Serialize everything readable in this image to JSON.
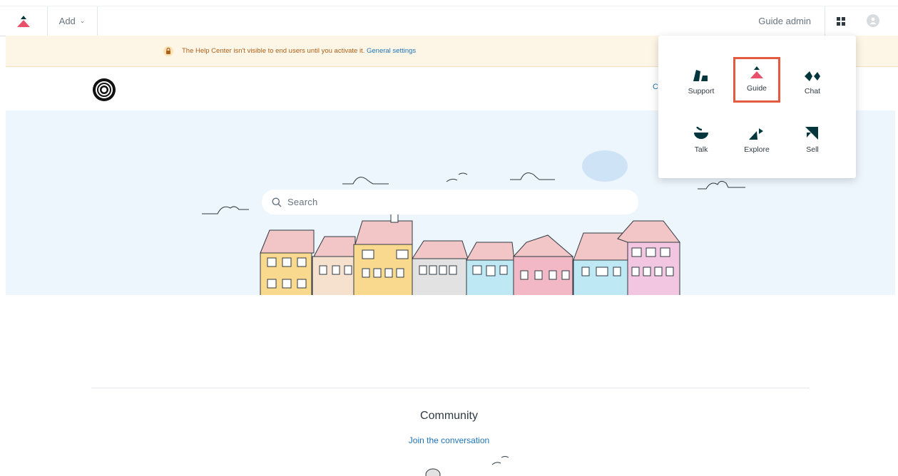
{
  "topbar": {
    "add_label": "Add",
    "admin_label": "Guide admin"
  },
  "notice": {
    "message": "The Help Center isn't visible to end users until you activate it.",
    "link_label": "General settings"
  },
  "hero": {
    "search_placeholder": "Search"
  },
  "header": {
    "nav_peek": "C"
  },
  "community": {
    "title": "Community",
    "link_label": "Join the conversation"
  },
  "product_tray": {
    "items": [
      {
        "label": "Support",
        "icon": "support-icon"
      },
      {
        "label": "Guide",
        "icon": "guide-icon",
        "selected": true
      },
      {
        "label": "Chat",
        "icon": "chat-icon"
      },
      {
        "label": "Talk",
        "icon": "talk-icon"
      },
      {
        "label": "Explore",
        "icon": "explore-icon"
      },
      {
        "label": "Sell",
        "icon": "sell-icon"
      }
    ]
  },
  "colors": {
    "brand_red": "#e8506b",
    "brand_dark": "#03363d",
    "link_blue": "#1f73b7",
    "notice_bg": "#fdf6e6",
    "hero_bg": "#eef6fd",
    "highlight": "#e35b3f"
  }
}
